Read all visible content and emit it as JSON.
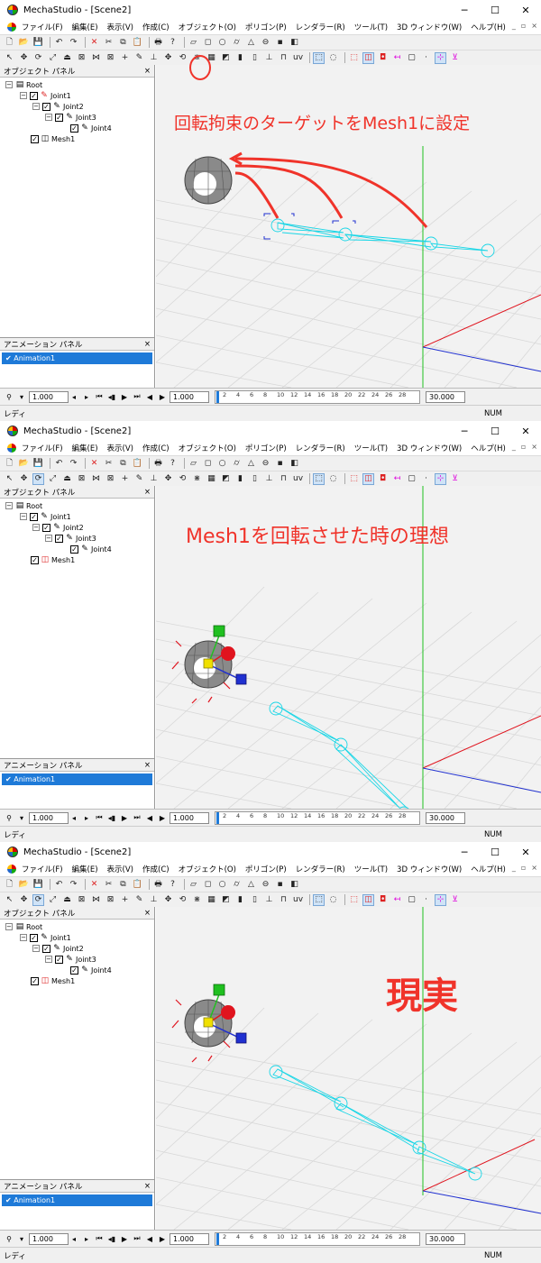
{
  "window": {
    "title": "MechaStudio - [Scene2]",
    "min_icon": "─",
    "max_icon": "☐",
    "close_icon": "✕"
  },
  "menu": [
    "ファイル(F)",
    "編集(E)",
    "表示(V)",
    "作成(C)",
    "オブジェクト(O)",
    "ポリゴン(P)",
    "レンダラー(R)",
    "ツール(T)",
    "3D ウィンドウ(W)",
    "ヘルプ(H)"
  ],
  "mdi_buttons": [
    "_",
    "▫",
    "×"
  ],
  "object_panel": {
    "title": "オブジェクト パネル",
    "close": "×",
    "nodes": [
      {
        "label": "Root",
        "icon": "root-icon"
      },
      {
        "label": "Joint1",
        "icon": "joint-icon"
      },
      {
        "label": "Joint2",
        "icon": "joint-icon"
      },
      {
        "label": "Joint3",
        "icon": "joint-icon"
      },
      {
        "label": "Joint4",
        "icon": "joint-icon"
      },
      {
        "label": "Mesh1",
        "icon": "mesh-icon"
      }
    ]
  },
  "animation_panel": {
    "title": "アニメーション パネル",
    "close": "×",
    "items": [
      "Animation1"
    ]
  },
  "timeline": {
    "speed": "1.000",
    "frame": "1.000",
    "end": "30.000",
    "ticks": [
      "2",
      "4",
      "6",
      "8",
      "10",
      "12",
      "14",
      "16",
      "18",
      "20",
      "22",
      "24",
      "26",
      "28"
    ]
  },
  "status": {
    "left": "レディ",
    "right": "NUM"
  },
  "annotations": [
    "回転拘束のターゲットをMesh1に設定",
    "Mesh1を回転させた時の理想",
    "現実"
  ],
  "colors": {
    "annotation": "#f0332a",
    "selection": "#1e7ad8",
    "bone": "#19d6e6",
    "grid": "#d6d6d6",
    "axis_x": "#e0141e",
    "axis_y": "#20c020",
    "axis_z": "#2030d0"
  }
}
